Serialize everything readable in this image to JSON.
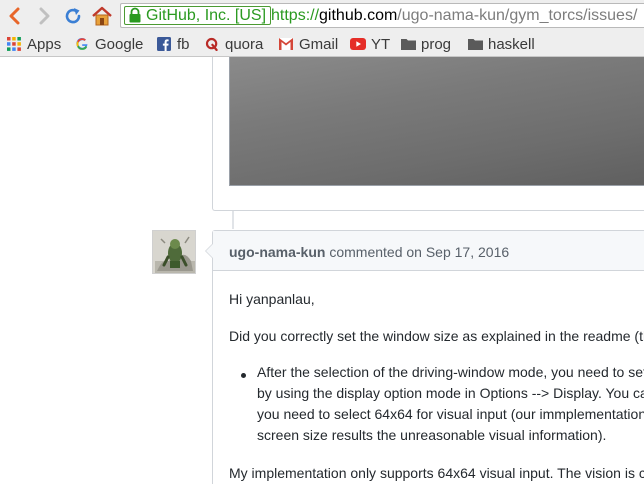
{
  "browser": {
    "security_label": "GitHub, Inc. [US]",
    "url_scheme": "https://",
    "url_host": "github.com",
    "url_path": "/ugo-nama-kun/gym_torcs/issues/",
    "bookmarks": [
      {
        "label": "Apps",
        "icon": "apps-grid-icon"
      },
      {
        "label": "Google",
        "icon": "google-icon"
      },
      {
        "label": "fb",
        "icon": "facebook-icon"
      },
      {
        "label": "quora",
        "icon": "quora-icon"
      },
      {
        "label": "Gmail",
        "icon": "gmail-icon"
      },
      {
        "label": "YT",
        "icon": "youtube-icon"
      },
      {
        "label": "prog",
        "icon": "folder-icon"
      },
      {
        "label": "haskell",
        "icon": "folder-icon"
      }
    ]
  },
  "comment": {
    "author": "ugo-nama-kun",
    "action": " commented on ",
    "date": "Sep 17, 2016",
    "greeting": "Hi yanpanlau,",
    "question": "Did you correctly set the window size as explained in the readme (th",
    "list_item_lines": [
      "After the selection of the driving-window mode, you need to set",
      "by using the display option mode in Options --> Display. You ca",
      "you need to select 64x64 for visual input (our immplementation",
      "screen size results the unreasonable visual information)."
    ],
    "closing": "My implementation only supports 64x64 visual input. The vision is c"
  },
  "colors": {
    "link_green": "#2a9a20",
    "border": "#d1d5da",
    "header_bg": "#f6f8fa",
    "text": "#24292e"
  }
}
